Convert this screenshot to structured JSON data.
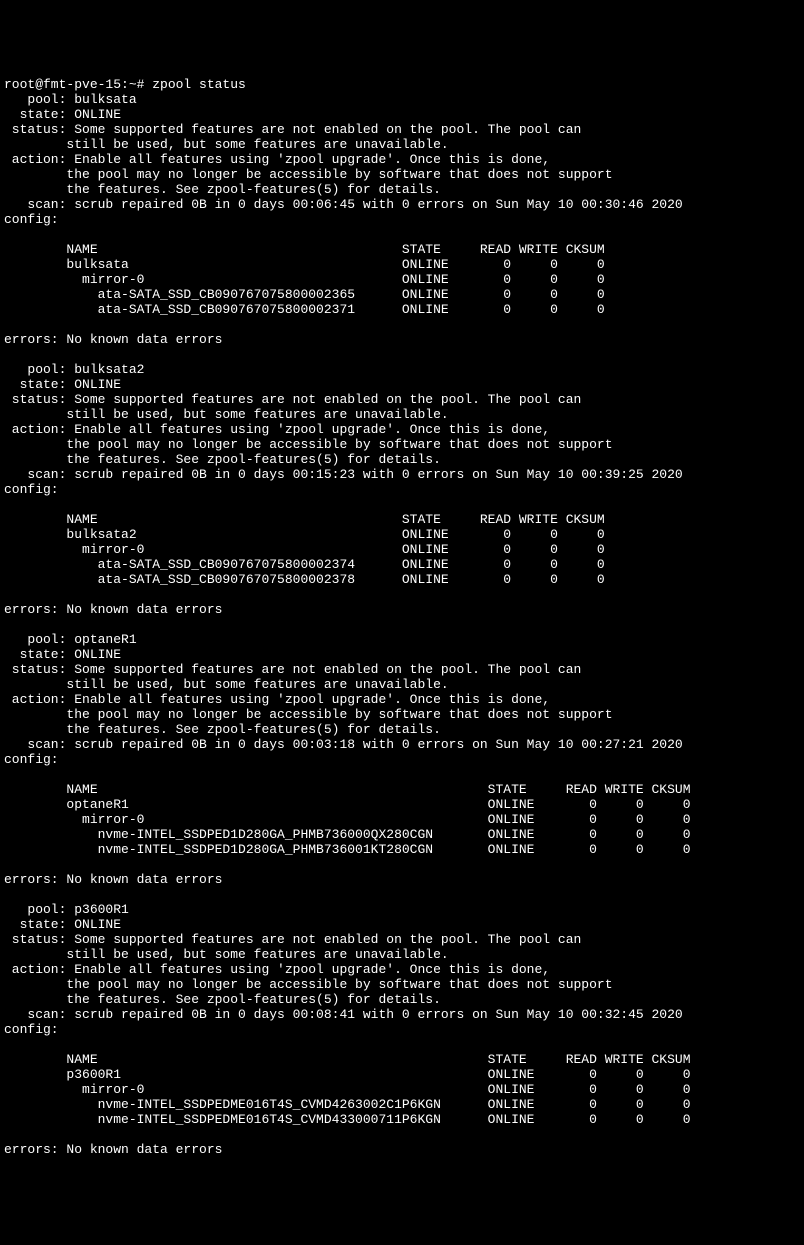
{
  "prompt": "root@fmt-pve-15:~# ",
  "command": "zpool status",
  "status_text_line1": "Some supported features are not enabled on the pool. The pool can",
  "status_text_line2": "still be used, but some features are unavailable.",
  "action_text_line1": "Enable all features using 'zpool upgrade'. Once this is done,",
  "action_text_line2": "the pool may no longer be accessible by software that does not support",
  "action_text_line3": "the features. See zpool-features(5) for details.",
  "errors_line": "No known data errors",
  "hdr": {
    "name": "NAME",
    "state": "STATE",
    "read": "READ",
    "write": "WRITE",
    "cksum": "CKSUM"
  },
  "pool_label": "pool:",
  "state_label": "state:",
  "status_label": "status:",
  "action_label": "action:",
  "scan_label": "scan:",
  "config_label": "config:",
  "errors_label": "errors:",
  "online": "ONLINE",
  "pools": [
    {
      "name": "bulksata",
      "scan": "scrub repaired 0B in 0 days 00:06:45 with 0 errors on Sun May 10 00:30:46 2020",
      "name_w": 43,
      "rows": [
        {
          "ind": 0,
          "name": "bulksata",
          "r": "0",
          "w": "0",
          "c": "0"
        },
        {
          "ind": 1,
          "name": "mirror-0",
          "r": "0",
          "w": "0",
          "c": "0"
        },
        {
          "ind": 2,
          "name": "ata-SATA_SSD_CB090767075800002365",
          "r": "0",
          "w": "0",
          "c": "0"
        },
        {
          "ind": 2,
          "name": "ata-SATA_SSD_CB090767075800002371",
          "r": "0",
          "w": "0",
          "c": "0"
        }
      ]
    },
    {
      "name": "bulksata2",
      "scan": "scrub repaired 0B in 0 days 00:15:23 with 0 errors on Sun May 10 00:39:25 2020",
      "name_w": 43,
      "rows": [
        {
          "ind": 0,
          "name": "bulksata2",
          "r": "0",
          "w": "0",
          "c": "0"
        },
        {
          "ind": 1,
          "name": "mirror-0",
          "r": "0",
          "w": "0",
          "c": "0"
        },
        {
          "ind": 2,
          "name": "ata-SATA_SSD_CB090767075800002374",
          "r": "0",
          "w": "0",
          "c": "0"
        },
        {
          "ind": 2,
          "name": "ata-SATA_SSD_CB090767075800002378",
          "r": "0",
          "w": "0",
          "c": "0"
        }
      ]
    },
    {
      "name": "optaneR1",
      "scan": "scrub repaired 0B in 0 days 00:03:18 with 0 errors on Sun May 10 00:27:21 2020",
      "name_w": 54,
      "rows": [
        {
          "ind": 0,
          "name": "optaneR1",
          "r": "0",
          "w": "0",
          "c": "0"
        },
        {
          "ind": 1,
          "name": "mirror-0",
          "r": "0",
          "w": "0",
          "c": "0"
        },
        {
          "ind": 2,
          "name": "nvme-INTEL_SSDPED1D280GA_PHMB736000QX280CGN",
          "r": "0",
          "w": "0",
          "c": "0"
        },
        {
          "ind": 2,
          "name": "nvme-INTEL_SSDPED1D280GA_PHMB736001KT280CGN",
          "r": "0",
          "w": "0",
          "c": "0"
        }
      ]
    },
    {
      "name": "p3600R1",
      "scan": "scrub repaired 0B in 0 days 00:08:41 with 0 errors on Sun May 10 00:32:45 2020",
      "name_w": 54,
      "rows": [
        {
          "ind": 0,
          "name": "p3600R1",
          "r": "0",
          "w": "0",
          "c": "0"
        },
        {
          "ind": 1,
          "name": "mirror-0",
          "r": "0",
          "w": "0",
          "c": "0"
        },
        {
          "ind": 2,
          "name": "nvme-INTEL_SSDPEDME016T4S_CVMD4263002C1P6KGN",
          "r": "0",
          "w": "0",
          "c": "0"
        },
        {
          "ind": 2,
          "name": "nvme-INTEL_SSDPEDME016T4S_CVMD433000711P6KGN",
          "r": "0",
          "w": "0",
          "c": "0"
        }
      ]
    }
  ]
}
